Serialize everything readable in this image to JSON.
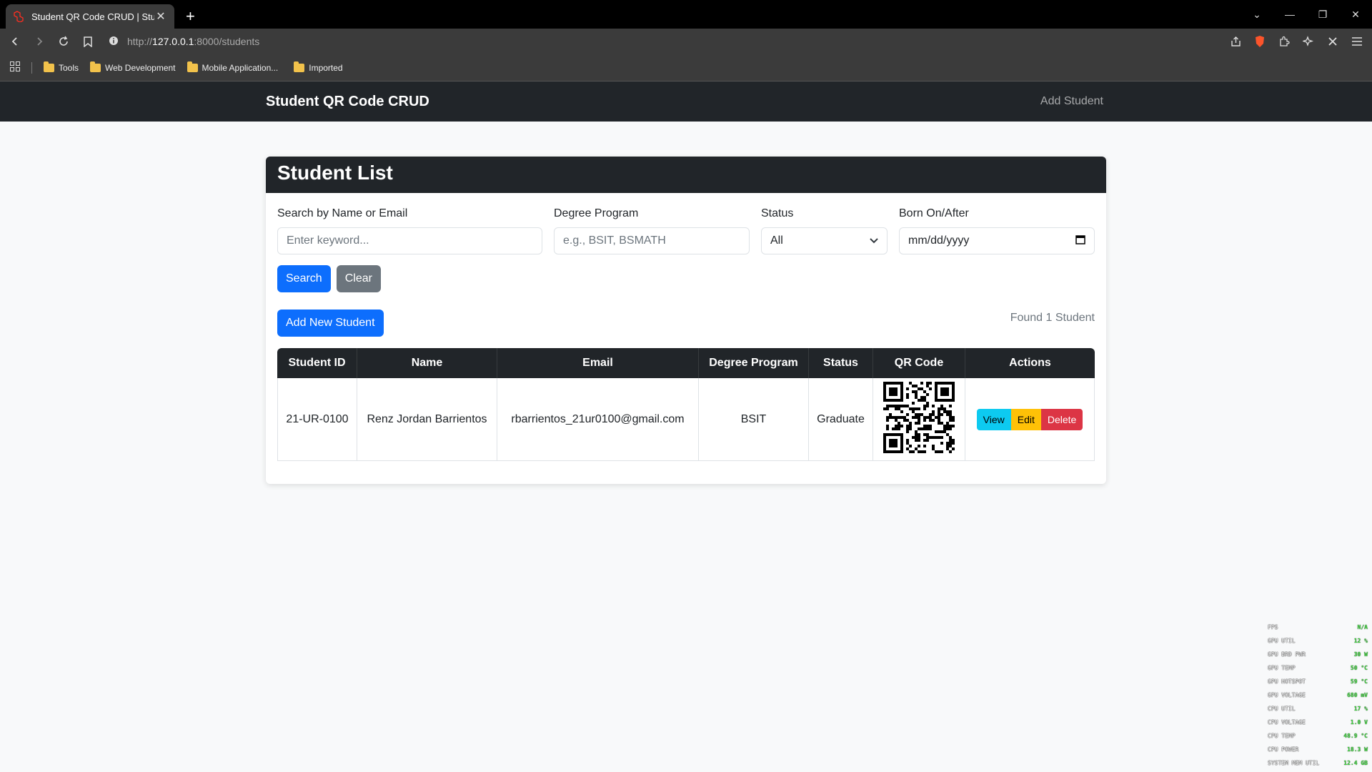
{
  "browser": {
    "tab_title": "Student QR Code CRUD | Stude",
    "url_prefix": "http://",
    "url_host": "127.0.0.1",
    "url_path": ":8000/students",
    "bookmarks": [
      "Tools",
      "Web Development",
      "Mobile Application...",
      "Imported"
    ]
  },
  "navbar": {
    "brand": "Student QR Code CRUD",
    "add_link": "Add Student"
  },
  "card": {
    "title": "Student List"
  },
  "filters": {
    "search_label": "Search by Name or Email",
    "search_placeholder": "Enter keyword...",
    "degree_label": "Degree Program",
    "degree_placeholder": "e.g., BSIT, BSMATH",
    "status_label": "Status",
    "status_value": "All",
    "born_label": "Born On/After",
    "born_value": "mm/dd/yyyy",
    "search_button": "Search",
    "clear_button": "Clear"
  },
  "list": {
    "add_button": "Add New Student",
    "found_text": "Found 1 Student",
    "columns": [
      "Student ID",
      "Name",
      "Email",
      "Degree Program",
      "Status",
      "QR Code",
      "Actions"
    ],
    "rows": [
      {
        "student_id": "21-UR-0100",
        "name": "Renz Jordan Barrientos",
        "email": "rbarrientos_21ur0100@gmail.com",
        "degree": "BSIT",
        "status": "Graduate",
        "view": "View",
        "edit": "Edit",
        "delete": "Delete"
      }
    ]
  },
  "overlay": [
    {
      "k": "FPS",
      "v": "N/A"
    },
    {
      "k": "GPU UTIL",
      "v": "12 %"
    },
    {
      "k": "GPU BRD PWR",
      "v": "30 W"
    },
    {
      "k": "GPU TEMP",
      "v": "50 °C"
    },
    {
      "k": "GPU HOTSPOT",
      "v": "59 °C"
    },
    {
      "k": "GPU VOLTAGE",
      "v": "680 mV"
    },
    {
      "k": "CPU UTIL",
      "v": "17 %"
    },
    {
      "k": "CPU VOLTAGE",
      "v": "1.0 V"
    },
    {
      "k": "CPU TEMP",
      "v": "48.9 °C"
    },
    {
      "k": "CPU POWER",
      "v": "18.3 W"
    },
    {
      "k": "SYSTEM MEM UTIL",
      "v": "12.4 GB"
    }
  ]
}
